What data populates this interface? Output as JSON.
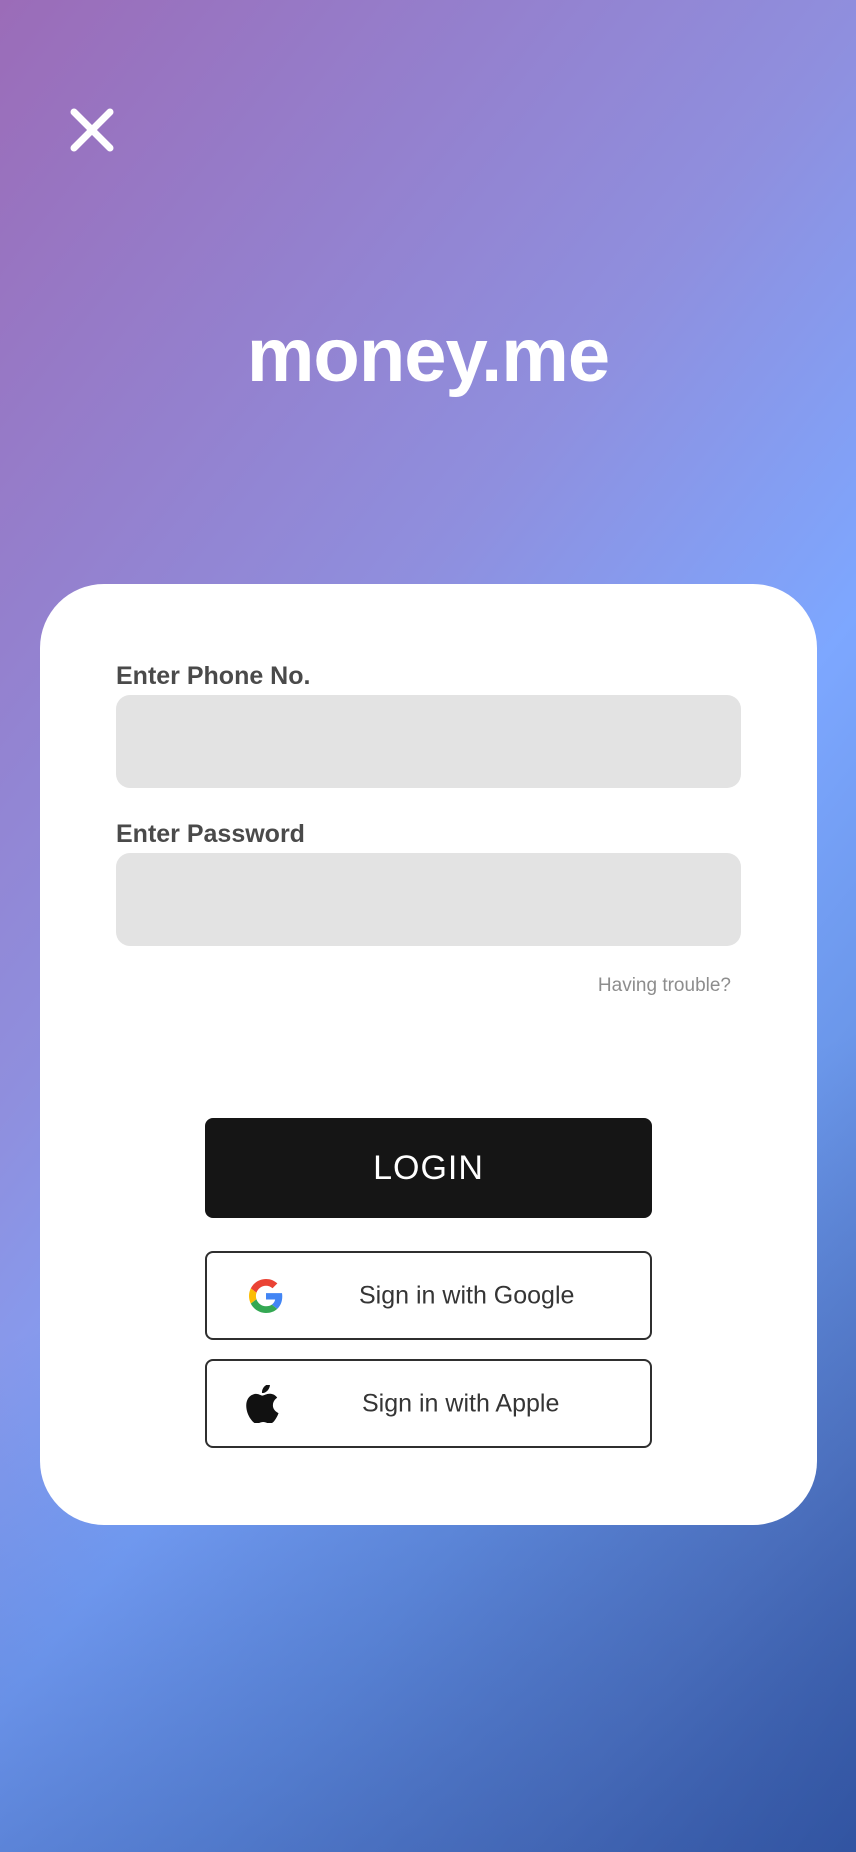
{
  "header": {
    "close_icon": "close-icon",
    "brand_name": "money.me"
  },
  "login_form": {
    "phone_label": "Enter Phone No.",
    "phone_value": "",
    "phone_placeholder": "",
    "password_label": "Enter Password",
    "password_value": "",
    "password_placeholder": "",
    "help_link": "Having trouble?",
    "login_button": "LOGIN"
  },
  "social_login": {
    "google_label": "Sign in with Google",
    "google_icon": "google-icon",
    "apple_label": "Sign in with Apple",
    "apple_icon": "apple-icon"
  },
  "colors": {
    "gradient_start": "#9b6cb8",
    "gradient_mid": "#7da7ff",
    "gradient_end": "#3d5fa9",
    "card_background": "#ffffff",
    "input_background": "#e3e3e3",
    "primary_button": "#151515",
    "text_dark": "#4a4a4a",
    "text_muted": "#8d8d8d"
  }
}
